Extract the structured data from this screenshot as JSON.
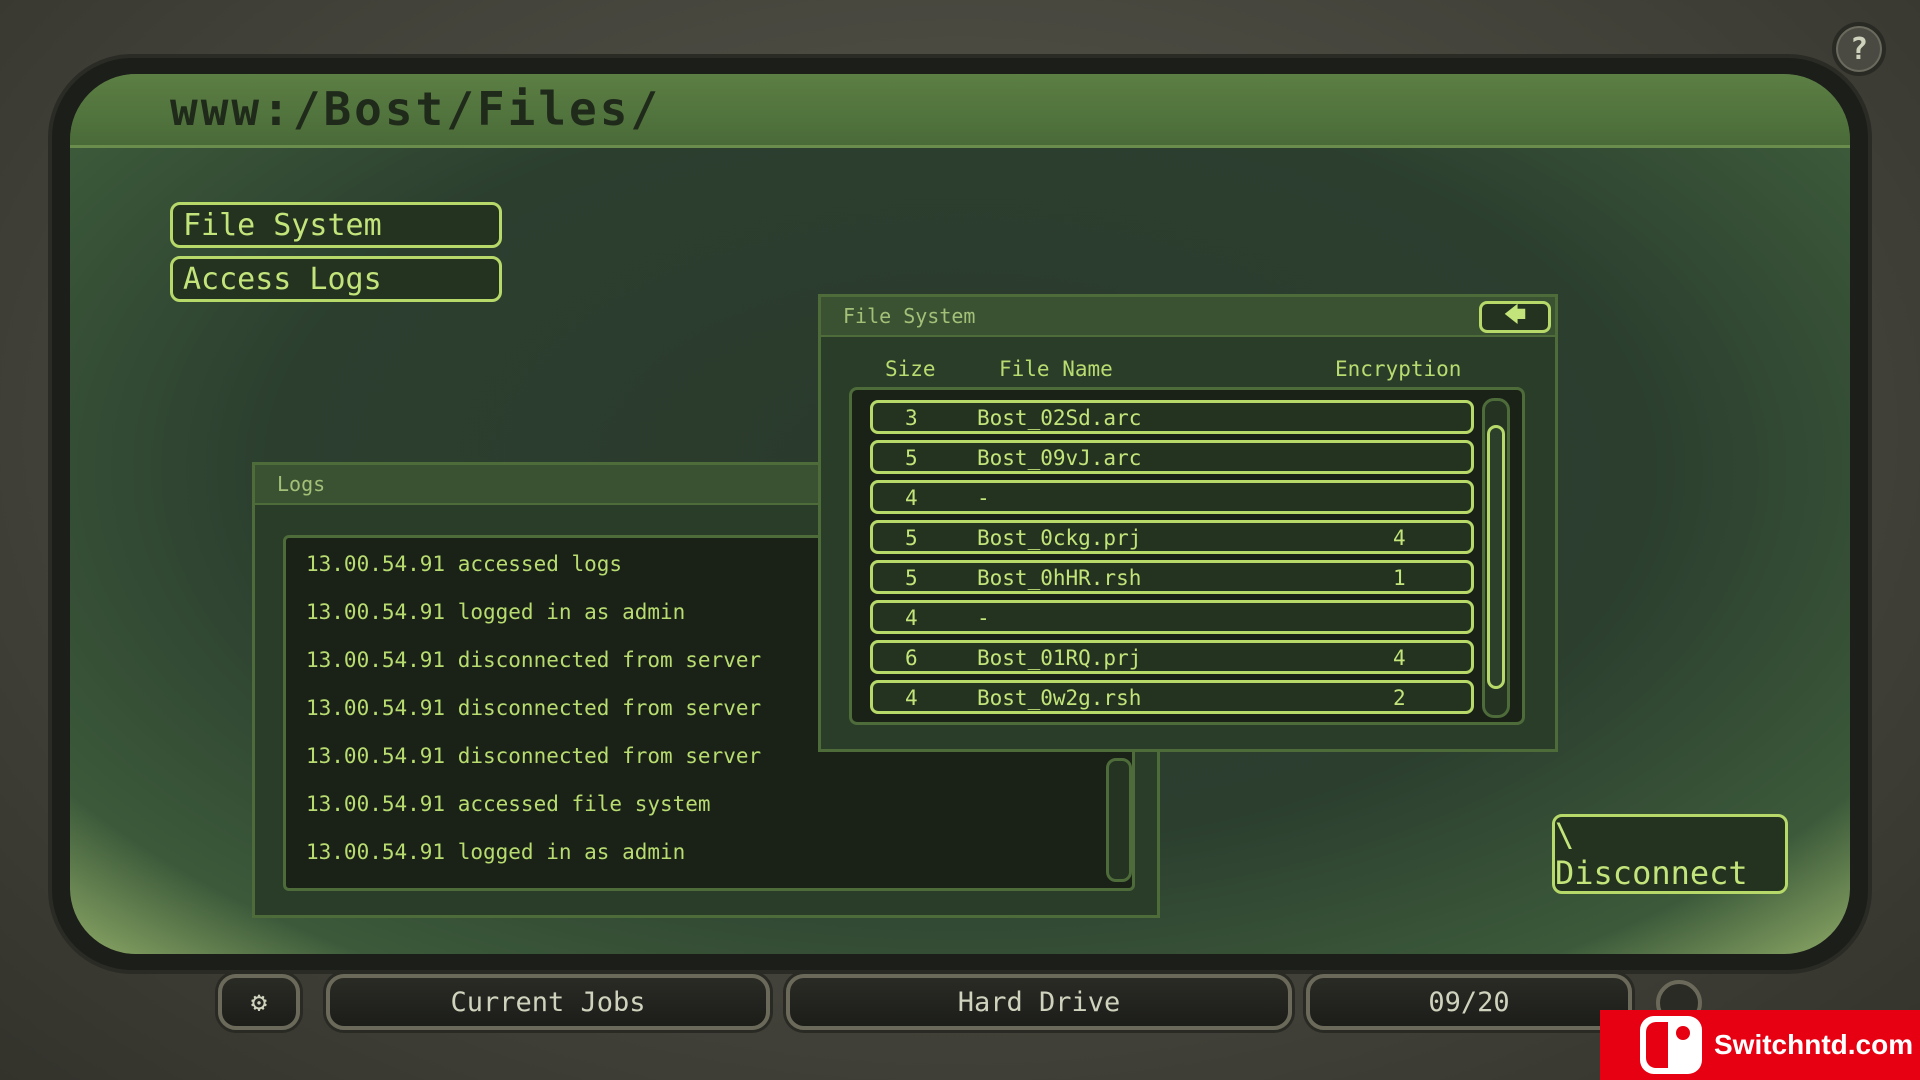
{
  "help": {
    "label": "?"
  },
  "address": "www:/Bost/Files/",
  "nav": {
    "file_system": "File System",
    "access_logs": "Access Logs"
  },
  "logs_panel": {
    "title": "Logs",
    "entries": [
      "13.00.54.91 accessed logs",
      "13.00.54.91 logged in as admin",
      "13.00.54.91 disconnected from server",
      "13.00.54.91 disconnected from server",
      "13.00.54.91 disconnected from server",
      "13.00.54.91 accessed file system",
      "13.00.54.91 logged in as admin"
    ]
  },
  "fs_panel": {
    "title": "File System",
    "back_icon": "arrow-left-icon",
    "back_label": "🡄",
    "columns": {
      "size": "Size",
      "name": "File Name",
      "encryption": "Encryption"
    },
    "rows": [
      {
        "size": "3",
        "name": "Bost_02Sd.arc",
        "encryption": ""
      },
      {
        "size": "5",
        "name": "Bost_09vJ.arc",
        "encryption": ""
      },
      {
        "size": "4",
        "name": "-",
        "encryption": ""
      },
      {
        "size": "5",
        "name": "Bost_0ckg.prj",
        "encryption": "4"
      },
      {
        "size": "5",
        "name": "Bost_0hHR.rsh",
        "encryption": "1"
      },
      {
        "size": "4",
        "name": "-",
        "encryption": ""
      },
      {
        "size": "6",
        "name": "Bost_01RQ.prj",
        "encryption": "4"
      },
      {
        "size": "4",
        "name": "Bost_0w2g.rsh",
        "encryption": "2"
      }
    ]
  },
  "disconnect": {
    "label": "\\ Disconnect"
  },
  "taskbar": {
    "settings_icon": "gear-icon",
    "settings_glyph": "⚙",
    "current_jobs": "Current Jobs",
    "hard_drive": "Hard Drive",
    "counter": "09/20"
  },
  "watermark": {
    "text": "Switchntd.com"
  }
}
